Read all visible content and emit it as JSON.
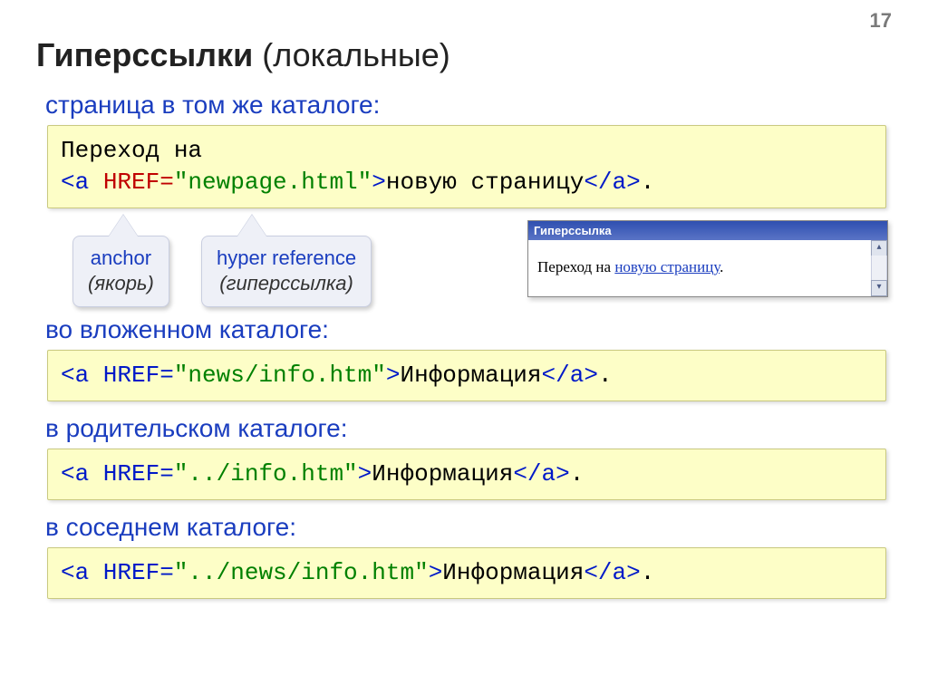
{
  "page_number": "17",
  "title_bold": "Гиперссылки",
  "title_rest": " (локальные)",
  "sect1": "страница в том же каталоге:",
  "code1": {
    "line1": "Переход на",
    "open1": "<a ",
    "attr": "HREF=",
    "val": "\"newpage.html\"",
    "gt": ">",
    "text": "новую страницу",
    "close": "</a>",
    "dot": "."
  },
  "callout1": {
    "t1": "anchor",
    "t2": "(якорь)"
  },
  "callout2": {
    "t1": "hyper reference",
    "t2": "(гиперссылка)"
  },
  "browser": {
    "title": "Гиперссылка",
    "body_prefix": "Переход на ",
    "body_link": "новую страницу",
    "body_suffix": "."
  },
  "sect2": "во вложенном каталоге:",
  "code2": {
    "open": "<a HREF=",
    "val": "\"news/info.htm\"",
    "gt": ">",
    "text": "Информация",
    "close": "</a>",
    "dot": "."
  },
  "sect3": "в родительском каталоге:",
  "code3": {
    "open": "<a HREF=",
    "val": "\"../info.htm\"",
    "gt": ">",
    "text": "Информация",
    "close": "</a>",
    "dot": "."
  },
  "sect4": "в соседнем каталоге:",
  "code4": {
    "open": "<a HREF=",
    "val": "\"../news/info.htm\"",
    "gt": ">",
    "text": "Информация",
    "close": "</a>",
    "dot": "."
  }
}
